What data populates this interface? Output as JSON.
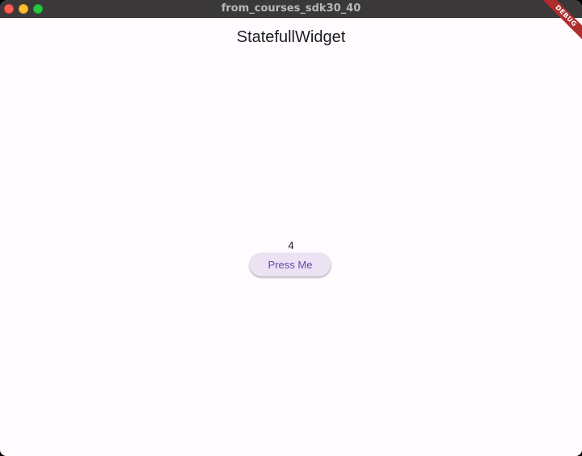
{
  "window": {
    "title": "from_courses_sdk30_40"
  },
  "app": {
    "title": "StatefullWidget",
    "counter": "4",
    "button_label": "Press Me",
    "debug_label": "DEBUG"
  },
  "colors": {
    "background": "#fffbfe",
    "button_bg": "#ebe3f3",
    "button_text": "#6445a8",
    "debug_banner": "#b02d2d"
  }
}
